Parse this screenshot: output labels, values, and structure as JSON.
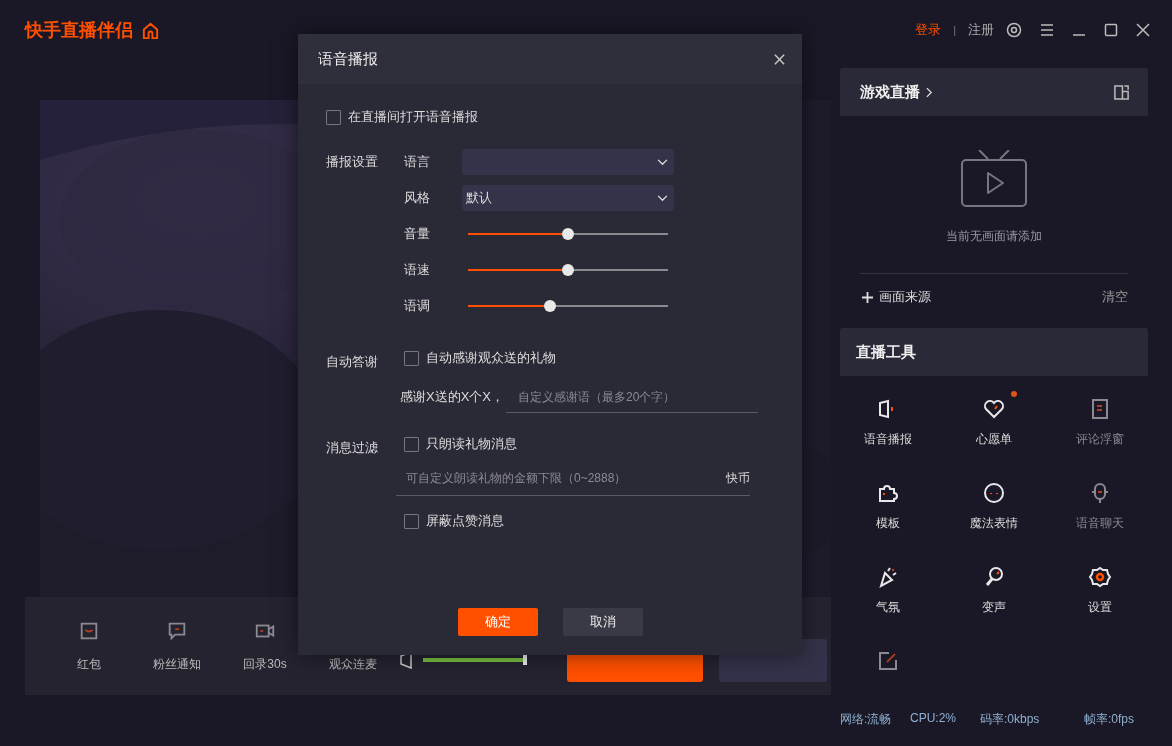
{
  "app": {
    "logo": "快手直播伴侣",
    "login": "登录",
    "separator": "|",
    "register": "注册"
  },
  "toolbar": {
    "items": [
      {
        "label": "红包"
      },
      {
        "label": "粉丝通知"
      },
      {
        "label": "回录30s"
      },
      {
        "label": "观众连麦"
      }
    ],
    "volume": {
      "level": 1
    }
  },
  "right_panel": {
    "scene": {
      "title": "游戏直播",
      "empty_text": "当前无画面请添加",
      "add_source": "画面来源",
      "clear": "清空"
    },
    "tools": {
      "title": "直播工具",
      "items": [
        {
          "label": "语音播报",
          "disabled": false,
          "notification": false
        },
        {
          "label": "心愿单",
          "disabled": false,
          "notification": true
        },
        {
          "label": "评论浮窗",
          "disabled": true,
          "notification": false
        },
        {
          "label": "模板",
          "disabled": false,
          "notification": false
        },
        {
          "label": "魔法表情",
          "disabled": false,
          "notification": false
        },
        {
          "label": "语音聊天",
          "disabled": true,
          "notification": false
        },
        {
          "label": "气氛",
          "disabled": false,
          "notification": false
        },
        {
          "label": "变声",
          "disabled": false,
          "notification": false
        },
        {
          "label": "设置",
          "disabled": false,
          "notification": false
        },
        {
          "disabled": true,
          "notification": false
        }
      ]
    }
  },
  "status_bar": [
    "网络:流畅",
    "CPU:2%",
    "码率:0kbps",
    "帧率:0fps"
  ],
  "dialog": {
    "title": "语音播报",
    "enable": {
      "label": "在直播间打开语音播报",
      "checked": false
    },
    "broadcast": {
      "label": "播报设置",
      "rows": [
        {
          "kind": "select",
          "label": "语言"
        },
        {
          "kind": "select",
          "label": "风格",
          "value": "默认"
        },
        {
          "kind": "slider",
          "label": "音量",
          "level": 0.5
        },
        {
          "kind": "slider",
          "label": "语速",
          "level": 0.5
        },
        {
          "kind": "slider",
          "label": "语调",
          "level": 0.41
        }
      ]
    },
    "thanks": {
      "label": "自动答谢",
      "checkbox": {
        "label": "自动感谢观众送的礼物",
        "checked": false
      },
      "template": "感谢X送的X个X，",
      "placeholder": "自定义感谢语（最多20个字）"
    },
    "filter": {
      "label": "消息过滤",
      "gift_only": {
        "label": "只朗读礼物消息",
        "checked": false
      },
      "placeholder": "可自定义朗读礼物的金额下限（0~2888）",
      "unit": "快币",
      "block_likes": {
        "label": "屏蔽点赞消息",
        "checked": false
      }
    },
    "ok": "确定",
    "cancel": "取消"
  }
}
